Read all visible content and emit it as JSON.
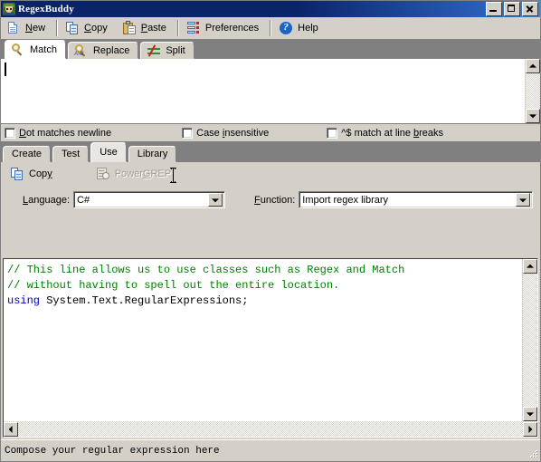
{
  "window": {
    "title": "RegexBuddy",
    "icon": "regexbuddy-app-icon",
    "controls": {
      "minimize": "Minimize",
      "maximize": "Maximize",
      "close": "Close"
    }
  },
  "toolbar": {
    "items": [
      {
        "label": "New",
        "accel": "N",
        "icon": "new-document-icon"
      },
      {
        "label": "Copy",
        "accel": "C",
        "icon": "copy-icon"
      },
      {
        "label": "Paste",
        "accel": "P",
        "icon": "paste-icon"
      },
      {
        "label": "Preferences",
        "accel": "",
        "icon": "preferences-icon"
      },
      {
        "label": "Help",
        "accel": "",
        "icon": "help-icon"
      }
    ]
  },
  "top_tabs": {
    "active": "Match",
    "items": [
      {
        "label": "Match",
        "icon": "magnifier-icon"
      },
      {
        "label": "Replace",
        "icon": "magnifier-replace-icon"
      },
      {
        "label": "Split",
        "icon": "split-icon"
      }
    ]
  },
  "regex_editor": {
    "value": "",
    "caret_visible": true
  },
  "options": [
    {
      "label": "Dot matches newline",
      "checked": false
    },
    {
      "label": "Case insensitive",
      "checked": false
    },
    {
      "label": "^$ match at line breaks",
      "checked": false
    }
  ],
  "bottom_tabs": {
    "active": "Use",
    "items": [
      {
        "label": "Create"
      },
      {
        "label": "Test"
      },
      {
        "label": "Use"
      },
      {
        "label": "Library"
      }
    ]
  },
  "use_panel": {
    "actions": [
      {
        "label": "Copy",
        "icon": "copy-icon",
        "enabled": true
      },
      {
        "label": "PowerGREP",
        "icon": "powergrep-icon",
        "enabled": false
      }
    ],
    "language": {
      "label": "Language:",
      "value": "C#"
    },
    "function": {
      "label": "Function:",
      "value": "Import regex library"
    }
  },
  "code": {
    "lines": [
      {
        "type": "comment",
        "text": "// This line allows us to use classes such as Regex and Match"
      },
      {
        "type": "comment",
        "text": "// without having to spell out the entire location."
      },
      {
        "type": "code",
        "keyword": "using",
        "rest": " System.Text.RegularExpressions;"
      }
    ]
  },
  "statusbar": {
    "text": "Compose your regular expression here"
  },
  "colors": {
    "titlebar_start": "#0a246a",
    "titlebar_end": "#4a82d6",
    "face": "#d4d0c8",
    "tabstrip": "#808080",
    "comment": "#008000",
    "keyword": "#0000c0",
    "disabled_text": "#a09c94"
  }
}
